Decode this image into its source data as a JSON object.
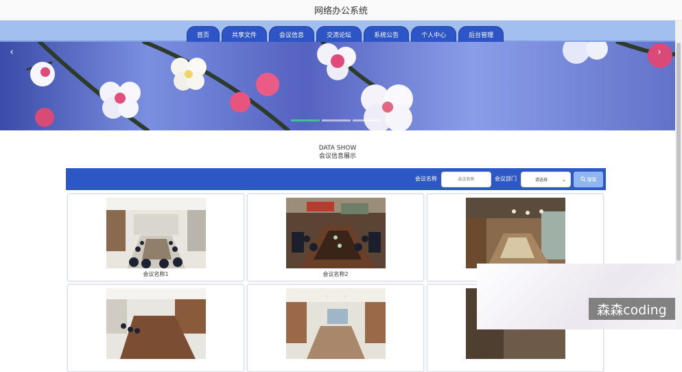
{
  "header": {
    "title": "网络办公系统"
  },
  "nav": {
    "tabs": [
      "首页",
      "共享文件",
      "会议信息",
      "交流论坛",
      "系统公告",
      "个人中心",
      "后台管理"
    ]
  },
  "banner": {
    "prev_icon": "chevron-left-icon",
    "next_icon": "chevron-right-icon",
    "slide_count": 3,
    "active_slide": 1
  },
  "section": {
    "title_en": "DATA SHOW",
    "title_cn": "会议信息展示"
  },
  "search": {
    "name_label": "会议名称",
    "name_placeholder": "会议名称",
    "dept_label": "会议部门",
    "dept_selected": "请选择",
    "button_label": "搜索"
  },
  "cards": [
    {
      "caption": "会议名称1"
    },
    {
      "caption": "会议名称2"
    },
    {
      "caption": ""
    },
    {
      "caption": ""
    },
    {
      "caption": ""
    },
    {
      "caption": ""
    }
  ],
  "watermark": {
    "text": "森森coding"
  },
  "colors": {
    "nav_bg": "#a2bff0",
    "tab_bg": "#2d55c6",
    "search_bar_bg": "#2d57c4",
    "search_btn_bg": "#8fb5f2",
    "active_dot": "#3fbf9a"
  }
}
